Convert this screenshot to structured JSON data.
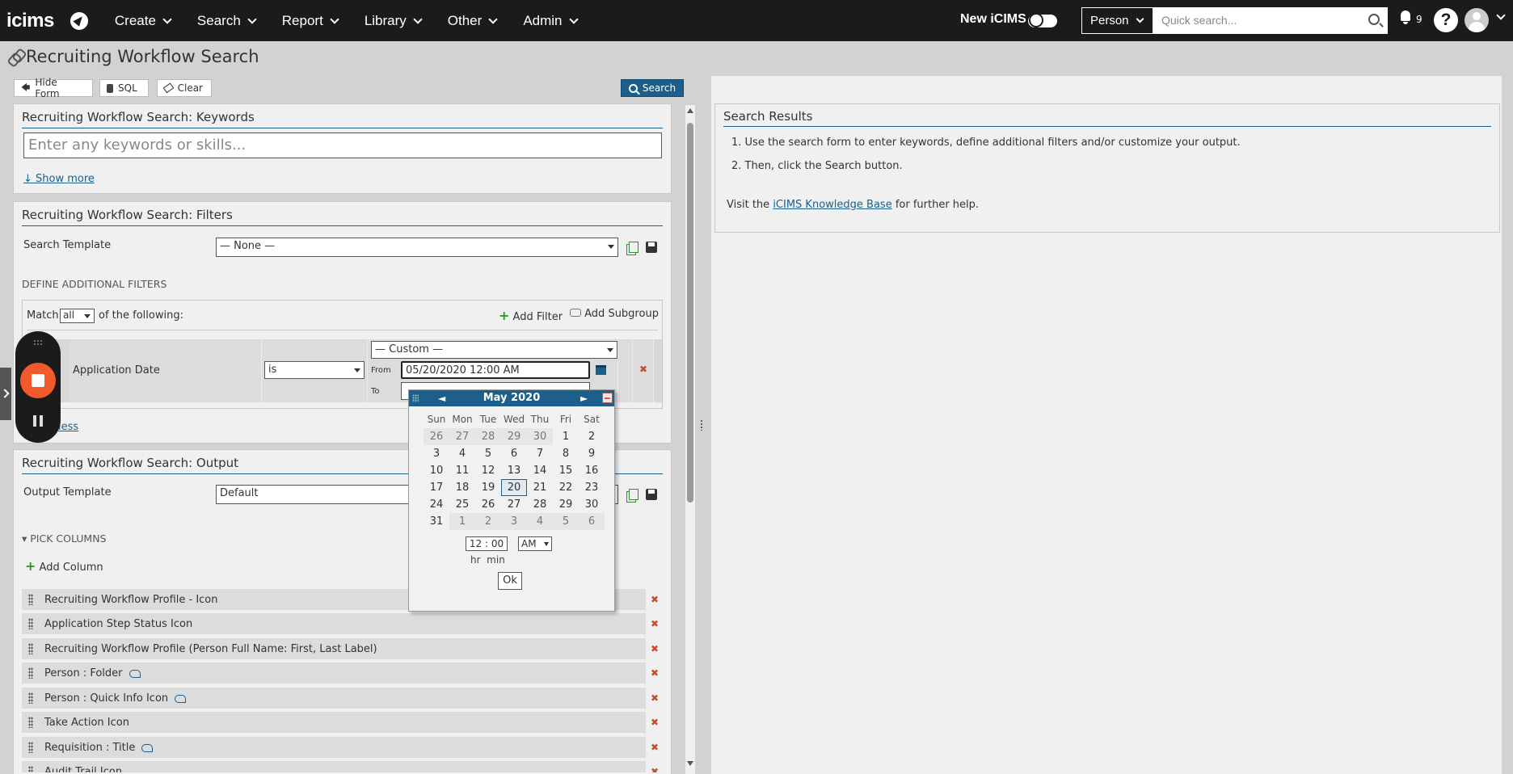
{
  "nav": {
    "logo": "icims",
    "items": [
      "Create",
      "Search",
      "Report",
      "Library",
      "Other",
      "Admin"
    ],
    "new_icims_label": "New iCIMS",
    "person_select": "Person",
    "quick_search_placeholder": "Quick search...",
    "notification_count": "9",
    "help_label": "?"
  },
  "page": {
    "title": "Recruiting Workflow Search"
  },
  "toolbar": {
    "hide_form": "Hide Form",
    "sql": "SQL",
    "clear": "Clear",
    "search": "Search"
  },
  "keywords": {
    "title": "Recruiting Workflow Search: Keywords",
    "placeholder": "Enter any keywords or skills...",
    "show_more": "↓ Show more"
  },
  "filters": {
    "title": "Recruiting Workflow Search: Filters",
    "template_label": "Search Template",
    "template_value": "— None —",
    "define_label": "DEFINE ADDITIONAL FILTERS",
    "match_prefix": "Match",
    "match_value": "all",
    "match_suffix": "of the following:",
    "add_filter": "Add Filter",
    "add_subgroup": "Add Subgroup",
    "row": {
      "field": "Application Date",
      "operator": "is",
      "range_type": "— Custom —",
      "from_label": "From",
      "from_value": "05/20/2020 12:00 AM",
      "to_label": "To",
      "to_value": ""
    },
    "show_less": "less"
  },
  "calendar": {
    "prev": "◄",
    "next": "►",
    "month_label": "May 2020",
    "days_of_week": [
      "Sun",
      "Mon",
      "Tue",
      "Wed",
      "Thu",
      "Fri",
      "Sat"
    ],
    "weeks": [
      [
        "26",
        "27",
        "28",
        "29",
        "30",
        "1",
        "2"
      ],
      [
        "3",
        "4",
        "5",
        "6",
        "7",
        "8",
        "9"
      ],
      [
        "10",
        "11",
        "12",
        "13",
        "14",
        "15",
        "16"
      ],
      [
        "17",
        "18",
        "19",
        "20",
        "21",
        "22",
        "23"
      ],
      [
        "24",
        "25",
        "26",
        "27",
        "28",
        "29",
        "30"
      ],
      [
        "31",
        "1",
        "2",
        "3",
        "4",
        "5",
        "6"
      ]
    ],
    "selected_day": "20",
    "time_value": "12 : 00",
    "ampm": "AM",
    "hr_min_label": "hr  min",
    "ok": "Ok"
  },
  "output": {
    "title": "Recruiting Workflow Search: Output",
    "template_label": "Output Template",
    "template_value": "Default",
    "pick_columns": "▾ PICK COLUMNS",
    "add_column": "Add Column",
    "columns": [
      {
        "label": "Recruiting Workflow Profile - Icon",
        "link": false
      },
      {
        "label": "Application Step Status Icon",
        "link": false
      },
      {
        "label": "Recruiting Workflow Profile (Person Full Name: First, Last Label)",
        "link": false
      },
      {
        "label": "Person : Folder",
        "link": true
      },
      {
        "label": "Person : Quick Info Icon",
        "link": true
      },
      {
        "label": "Take Action Icon",
        "link": false
      },
      {
        "label": "Requisition : Title",
        "link": true
      },
      {
        "label": "Audit Trail Icon",
        "link": false
      }
    ]
  },
  "results": {
    "title": "Search Results",
    "step1": "1. Use the search form to enter keywords, define additional filters and/or customize your output.",
    "step2": "2. Then, click the Search button.",
    "kb_prefix": "Visit the ",
    "kb_link": "iCIMS Knowledge Base",
    "kb_suffix": " for further help."
  }
}
